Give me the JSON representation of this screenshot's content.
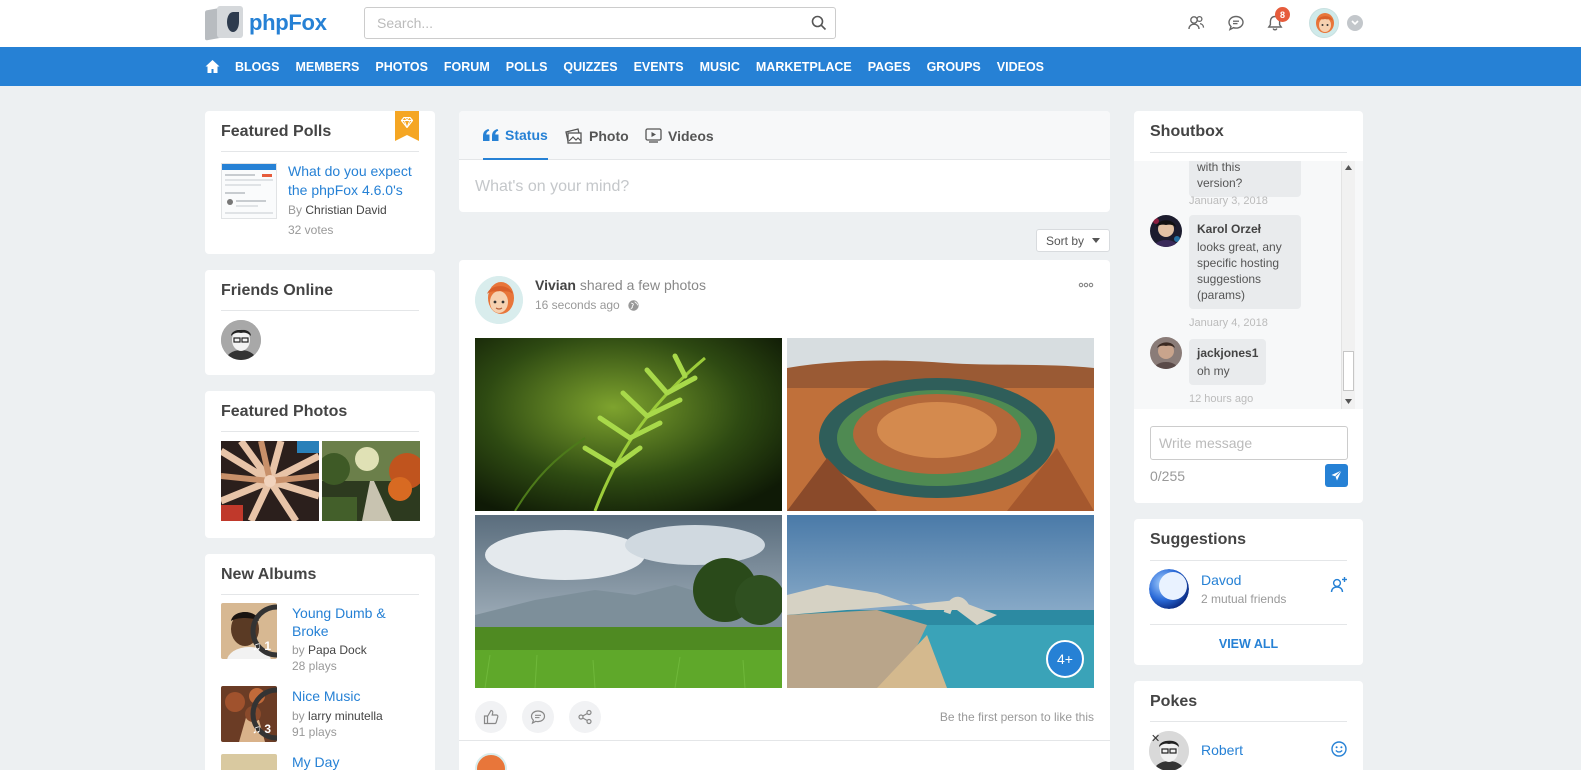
{
  "header": {
    "logo_text": "phpFox",
    "search_placeholder": "Search...",
    "notification_count": "8",
    "icons": [
      "friends-icon",
      "messages-icon",
      "bell-icon",
      "chevron-down-icon"
    ]
  },
  "nav": {
    "items": [
      "BLOGS",
      "MEMBERS",
      "PHOTOS",
      "FORUM",
      "POLLS",
      "QUIZZES",
      "EVENTS",
      "MUSIC",
      "MARKETPLACE",
      "PAGES",
      "GROUPS",
      "VIDEOS"
    ]
  },
  "featured_polls": {
    "title": "Featured Polls",
    "poll_question": "What do you expect the phpFox 4.6.0's",
    "by_label": "By",
    "author": "Christian David",
    "votes": "32 votes"
  },
  "friends_online": {
    "title": "Friends Online"
  },
  "featured_photos": {
    "title": "Featured Photos"
  },
  "new_albums": {
    "title": "New Albums",
    "items": [
      {
        "name": "Young Dumb & Broke",
        "by_label": "by",
        "artist": "Papa Dock",
        "plays": "28 plays",
        "count": "1"
      },
      {
        "name": "Nice Music",
        "by_label": "by",
        "artist": "larry minutella",
        "plays": "91 plays",
        "count": "3"
      },
      {
        "name": "My Day"
      }
    ]
  },
  "composer": {
    "tabs": [
      "Status",
      "Photo",
      "Videos"
    ],
    "placeholder": "What's on your mind?"
  },
  "feed": {
    "sort_label": "Sort by",
    "post": {
      "author": "Vivian",
      "action": "shared a few photos",
      "time": "16 seconds ago",
      "more_photos": "4+",
      "like_status": "Be the first person to like this"
    }
  },
  "shoutbox": {
    "title": "Shoutbox",
    "messages": [
      {
        "text_tail_1": "with this",
        "text_tail_2": "version?",
        "time": "January 3, 2018"
      },
      {
        "author": "Karol Orzeł",
        "text": "looks great, any specific hosting suggestions (params)",
        "time": "January 4, 2018"
      },
      {
        "author": "jackjones1",
        "text": "oh my",
        "time": "12 hours ago"
      }
    ],
    "input_placeholder": "Write message",
    "char_count": "0/255"
  },
  "suggestions": {
    "title": "Suggestions",
    "items": [
      {
        "name": "Davod",
        "mutual": "2 mutual friends"
      }
    ],
    "view_all": "VIEW ALL"
  },
  "pokes": {
    "title": "Pokes",
    "items": [
      {
        "name": "Robert"
      }
    ]
  },
  "colors": {
    "accent": "#2681d5",
    "background": "#edf0f2",
    "badge": "#e65c3c",
    "ribbon": "#f5a623"
  }
}
